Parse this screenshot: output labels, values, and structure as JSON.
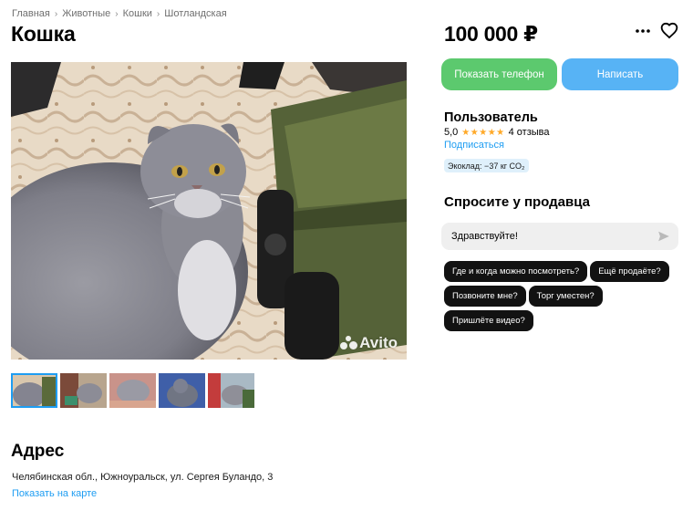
{
  "breadcrumb": [
    "Главная",
    "Животные",
    "Кошки",
    "Шотландская"
  ],
  "breadcrumb_separator": "›",
  "title": "Кошка",
  "price": "100 000 ₽",
  "actions": {
    "more_icon": "more-dots-icon",
    "favorite_icon": "heart-outline-icon",
    "show_phone": "Показать телефон",
    "write": "Написать",
    "show_phone_color": "#5cc96e",
    "write_color": "#57b3f5"
  },
  "seller": {
    "name": "Пользователь",
    "rating": "5,0",
    "stars": "★★★★★",
    "reviews": "4 отзыва",
    "subscribe": "Подписаться",
    "eco_badge": "Экоклад: −37 кг CO₂"
  },
  "ask": {
    "title": "Спросите у продавца",
    "input_value": "Здравствуйте!",
    "send_icon": "send-arrow-icon",
    "quick_questions": [
      "Где и когда можно посмотреть?",
      "Ещё продаёте?",
      "Позвоните мне?",
      "Торг уместен?",
      "Пришлёте видео?"
    ]
  },
  "gallery": {
    "watermark": "Avito",
    "thumbnail_count": 5,
    "active_thumbnail": 1
  },
  "address": {
    "title": "Адрес",
    "text": "Челябинская обл., Южноуральск, ул. Сергея Буландо, 3",
    "map_link": "Показать на карте"
  },
  "colors": {
    "link": "#1e9df2",
    "chip_bg": "#121212",
    "star": "#ffa928"
  }
}
